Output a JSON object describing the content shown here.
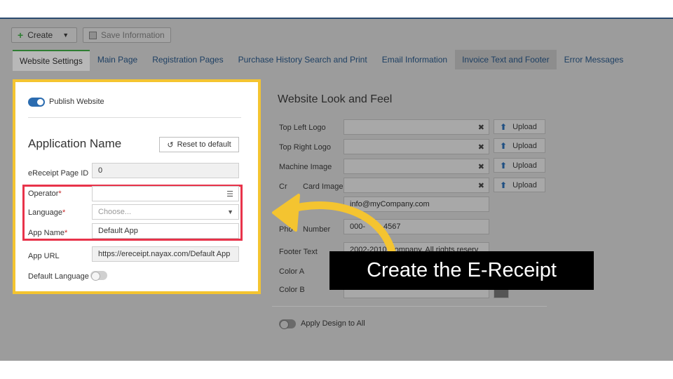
{
  "toolbar": {
    "create_label": "Create",
    "save_label": "Save Information"
  },
  "tabs": [
    {
      "label": "Website Settings"
    },
    {
      "label": "Main Page"
    },
    {
      "label": "Registration Pages"
    },
    {
      "label": "Purchase History Search and Print"
    },
    {
      "label": "Email Information"
    },
    {
      "label": "Invoice Text and Footer"
    },
    {
      "label": "Error Messages"
    }
  ],
  "left_panel": {
    "publish_label": "Publish Website",
    "app_name_heading": "Application Name",
    "reset_label": "Reset to default",
    "page_id_label": "eReceipt Page ID",
    "page_id_value": "0",
    "operator_label": "Operator",
    "language_label": "Language",
    "language_placeholder": "Choose...",
    "app_name_label": "App Name",
    "app_name_value": "Default App",
    "app_url_label": "App URL",
    "app_url_value": "https://ereceipt.nayax.com/Default App",
    "default_language_label": "Default Language",
    "required_mark": "*"
  },
  "right_panel": {
    "title": "Website Look and Feel",
    "top_left_logo": "Top Left Logo",
    "top_right_logo": "Top Right Logo",
    "machine_image": "Machine Image",
    "credit_card_image_partial": "Cr",
    "credit_card_image_end": "Card Image",
    "email_value": "info@myCompany.com",
    "phone_label_partial": "Pho",
    "phone_label_end": "Number",
    "phone_value_a": "000-",
    "phone_value_b": "4567",
    "footer_text_label": "Footer Text",
    "footer_text_value": "2002-2010       Company. All rights reserv",
    "color_a_label": "Color A",
    "color_b_label": "Color B",
    "upload_label": "Upload",
    "clear_glyph": "✖",
    "apply_label": "Apply Design to All"
  },
  "callout": {
    "text": "Create the E-Receipt"
  }
}
